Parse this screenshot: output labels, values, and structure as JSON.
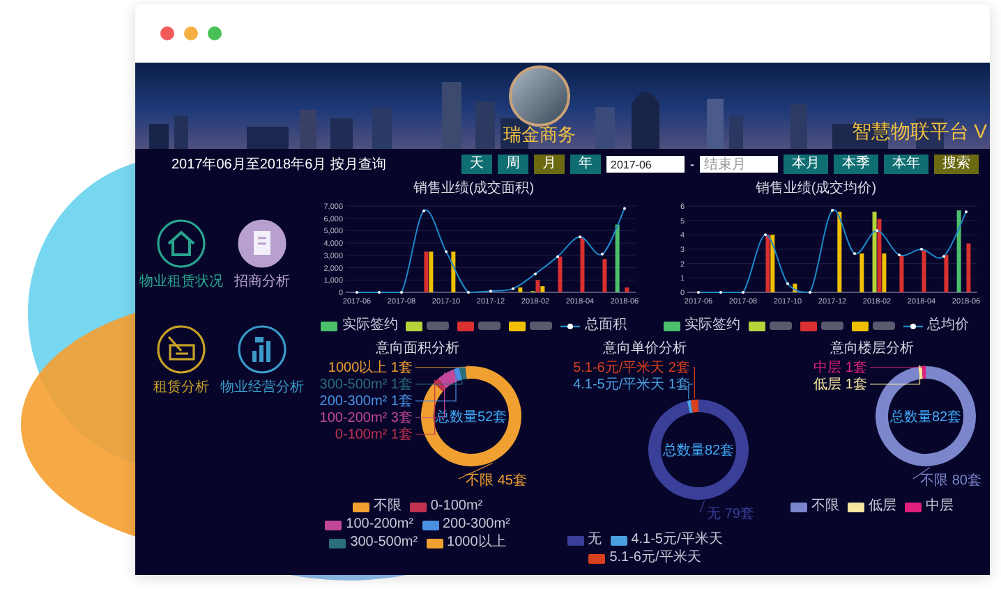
{
  "banner": {
    "brand": "瑞金商务",
    "platform_title": "智慧物联平台 V"
  },
  "query": {
    "summary": "2017年06月至2018年6月 按月查询",
    "period_tabs": [
      {
        "label": "天",
        "selected": false
      },
      {
        "label": "周",
        "selected": false
      },
      {
        "label": "月",
        "selected": true
      },
      {
        "label": "年",
        "selected": false
      }
    ],
    "start_month": {
      "value": "2017-06"
    },
    "separator": "-",
    "end_month": {
      "placeholder": "结束月"
    },
    "quick_ranges": [
      {
        "label": "本月"
      },
      {
        "label": "本季"
      },
      {
        "label": "本年"
      }
    ],
    "search_button": "搜索"
  },
  "nav_items": [
    {
      "label": "物业租赁状况",
      "kind": "house",
      "color": "#2aa58f",
      "filled": false
    },
    {
      "label": "招商分析",
      "kind": "document",
      "color": "#b79fd0",
      "filled": true
    },
    {
      "label": "租赁分析",
      "kind": "card",
      "color": "#c9a227",
      "filled": false
    },
    {
      "label": "物业经营分析",
      "kind": "bars",
      "color": "#3a9bc9",
      "filled": false
    }
  ],
  "sales_charts": [
    {
      "chart_data": {
        "type": "bar",
        "title": "销售业绩(成交面积)",
        "grid": true,
        "categories": [
          "2017-06",
          null,
          "2017-08",
          null,
          "2017-10",
          null,
          "2017-12",
          null,
          "2018-02",
          null,
          "2018-04",
          null,
          "2018-06"
        ],
        "ylim": [
          0,
          7000
        ],
        "yticks": [
          0,
          {
            "value": 1000,
            "label": "1,000"
          },
          {
            "value": 2000,
            "label": "2,000"
          },
          {
            "value": 3000,
            "label": "3,000"
          },
          {
            "value": 4000,
            "label": "4,000"
          },
          {
            "value": 5000,
            "label": "5,000"
          },
          {
            "value": 6000,
            "label": "6,000"
          },
          {
            "value": 7000,
            "label": "7,000"
          }
        ],
        "series": [
          {
            "name": "实际签约",
            "type": "bar",
            "color": "#4cbf6b",
            "values": [
              null,
              null,
              null,
              null,
              null,
              null,
              null,
              null,
              null,
              null,
              null,
              null,
              5500
            ]
          },
          {
            "type": "bar",
            "color": "#b5d33a",
            "values": [
              null,
              null,
              null,
              null,
              null,
              null,
              null,
              null,
              100,
              null,
              null,
              null,
              null
            ]
          },
          {
            "type": "bar",
            "color": "#d93030",
            "values": [
              null,
              null,
              null,
              3300,
              null,
              null,
              null,
              null,
              1000,
              2900,
              4400,
              2700,
              400
            ]
          },
          {
            "type": "bar",
            "color": "#f0c000",
            "values": [
              null,
              null,
              null,
              3300,
              3300,
              null,
              null,
              400,
              500,
              null,
              null,
              null,
              null
            ]
          },
          {
            "name": "总面积",
            "type": "line",
            "color": "#1e88c8",
            "values": [
              0,
              0,
              0,
              6600,
              3300,
              0,
              100,
              300,
              1500,
              2900,
              4500,
              3100,
              6800
            ]
          }
        ]
      }
    },
    {
      "chart_data": {
        "type": "bar",
        "title": "销售业绩(成交均价)",
        "grid": true,
        "categories": [
          "2017-06",
          null,
          "2017-08",
          null,
          "2017-10",
          null,
          "2017-12",
          null,
          "2018-02",
          null,
          "2018-04",
          null,
          "2018-06"
        ],
        "ylim": [
          0,
          6
        ],
        "yticks": [
          0,
          1,
          2,
          3,
          4,
          5,
          6
        ],
        "series": [
          {
            "name": "实际签约",
            "type": "bar",
            "color": "#4cbf6b",
            "values": [
              null,
              null,
              null,
              null,
              null,
              null,
              null,
              null,
              null,
              null,
              null,
              null,
              5.7
            ]
          },
          {
            "type": "bar",
            "color": "#b5d33a",
            "values": [
              null,
              null,
              null,
              null,
              null,
              null,
              null,
              null,
              5.6,
              null,
              null,
              null,
              null
            ]
          },
          {
            "type": "bar",
            "color": "#d93030",
            "values": [
              null,
              null,
              null,
              4,
              null,
              null,
              null,
              null,
              5.1,
              2.6,
              2.9,
              2.6,
              3.4
            ]
          },
          {
            "type": "bar",
            "color": "#f0c000",
            "values": [
              null,
              null,
              null,
              4,
              0.6,
              null,
              5.6,
              2.7,
              2.7,
              null,
              null,
              null,
              null
            ]
          },
          {
            "name": "总均价",
            "type": "line",
            "color": "#1e88c8",
            "values": [
              0,
              0,
              0,
              4,
              0.6,
              0,
              5.7,
              2.7,
              4.3,
              2.6,
              3,
              2.5,
              5.6
            ]
          }
        ]
      }
    }
  ],
  "donut_charts": [
    {
      "center_label": "总数量52套",
      "chart_data": {
        "type": "donut",
        "title": "意向面积分析",
        "categories": [
          "不限",
          "0-100m²",
          "100-200m²",
          "200-300m²",
          "300-500m²",
          "1000以上"
        ],
        "values": [
          45,
          1,
          3,
          1,
          1,
          1
        ],
        "colors": [
          "#f0a030",
          "#c2304f",
          "#c0479a",
          "#4a90e2",
          "#2a6f7a",
          "#f0a030"
        ],
        "value_labels": [
          "不限 45套",
          "0-100m² 1套",
          "100-200m² 3套",
          "200-300m² 1套",
          "300-500m² 1套",
          "1000以上 1套"
        ]
      }
    },
    {
      "center_label": "总数量82套",
      "chart_data": {
        "type": "donut",
        "title": "意向单价分析",
        "categories": [
          "无",
          "4.1-5元/平米天",
          "5.1-6元/平米天"
        ],
        "values": [
          79,
          1,
          2
        ],
        "colors": [
          "#3a3f9a",
          "#4aa0e0",
          "#d8401e"
        ],
        "value_labels": [
          "无 79套",
          "4.1-5元/平米天 1套",
          "5.1-6元/平米天 2套"
        ]
      }
    },
    {
      "center_label": "总数量82套",
      "chart_data": {
        "type": "donut",
        "title": "意向楼层分析",
        "categories": [
          "不限",
          "低层",
          "中层"
        ],
        "values": [
          80,
          1,
          1
        ],
        "colors": [
          "#7b86cc",
          "#f5e6a0",
          "#e0207a"
        ],
        "value_labels": [
          "不限 80套",
          "低层 1套",
          "中层 1套"
        ]
      }
    }
  ]
}
